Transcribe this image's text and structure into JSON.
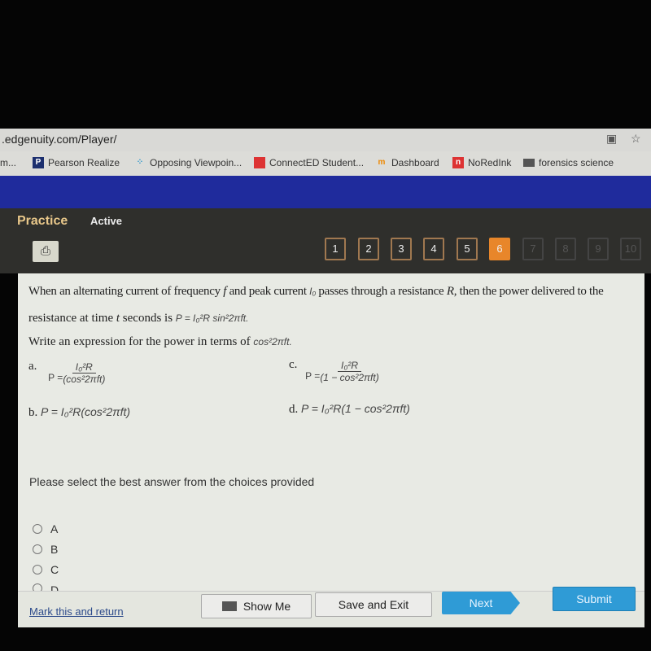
{
  "browser": {
    "url": ".edgenuity.com/Player/",
    "bookmarks": [
      {
        "label": "m..."
      },
      {
        "label": "Pearson Realize",
        "icon": "P"
      },
      {
        "label": "Opposing Viewpoin..."
      },
      {
        "label": "ConnectED Student..."
      },
      {
        "label": "Dashboard",
        "icon": "m"
      },
      {
        "label": "NoRedInk",
        "icon": "n"
      },
      {
        "label": "forensics science"
      }
    ]
  },
  "header": {
    "title": "Practice",
    "status": "Active",
    "pages": [
      "1",
      "2",
      "3",
      "4",
      "5",
      "6",
      "7",
      "8",
      "9",
      "10"
    ],
    "current_page": "6"
  },
  "question": {
    "line1_a": "When an alternating current of frequency ",
    "f": "f",
    "line1_b": " and peak current ",
    "I0": "I₀",
    "line1_c": " passes through a resistance ",
    "R": "R",
    "line1_d": ", then the power delivered to the",
    "line2": "resistance at time ",
    "t": "t",
    "line2_b": " seconds is ",
    "formula": "P = I₀²R sin²2πft.",
    "line3": "Write an expression for the power in terms of ",
    "cos": "cos²2πft.",
    "choices": [
      {
        "label": "a.",
        "lhs": "P =",
        "num": "I₀²R",
        "den": "(cos²2πft)"
      },
      {
        "label": "b.",
        "expr": "P = I₀²R(cos²2πft)"
      },
      {
        "label": "c.",
        "lhs": "P =",
        "num": "I₀²R",
        "den": "(1 − cos²2πft)"
      },
      {
        "label": "d.",
        "expr": "P = I₀²R(1 − cos²2πft)"
      }
    ]
  },
  "prompt": "Please select the best answer from the choices provided",
  "options": [
    "A",
    "B",
    "C",
    "D"
  ],
  "footer": {
    "mark": "Mark this and return",
    "show_me": "Show Me",
    "save_exit": "Save and Exit",
    "next": "Next",
    "submit": "Submit"
  },
  "colors": {
    "accent": "#e8862a",
    "button_blue": "#2f9bd6",
    "nav_blue": "#1f2b9c"
  }
}
